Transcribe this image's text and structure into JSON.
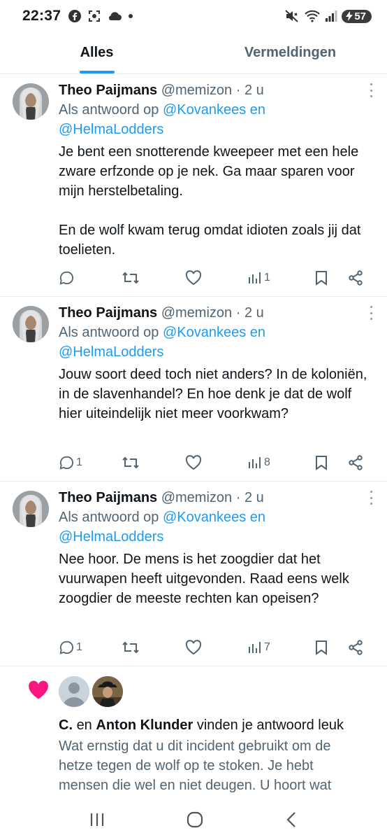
{
  "status_bar": {
    "time": "22:37",
    "battery": "57"
  },
  "tabs": [
    {
      "label": "Alles",
      "active": true
    },
    {
      "label": "Vermeldingen",
      "active": false
    }
  ],
  "tweets": [
    {
      "name": "Theo Paijmans",
      "handle": "@memizon",
      "dot": "·",
      "time": "2 u",
      "reply_prefix": "Als antwoord op",
      "reply_mention_1": "@Kovankees en",
      "reply_mention_2": "@HelmaLodders",
      "text": "Je bent een snotterende kweepeer met een hele zware erfzonde op je nek. Ga maar sparen voor mijn herstelbetaling.\n\nEn de wolf kwam terug omdat idioten zoals jij dat toelieten.",
      "replies": "",
      "views": "1"
    },
    {
      "name": "Theo Paijmans",
      "handle": "@memizon",
      "dot": "·",
      "time": "2 u",
      "reply_prefix": "Als antwoord op",
      "reply_mention_1": "@Kovankees en",
      "reply_mention_2": "@HelmaLodders",
      "text": "Jouw soort deed toch niet anders? In de koloniën, in de slavenhandel? En hoe denk je dat de wolf hier uiteindelijk niet meer voorkwam?",
      "replies": "1",
      "views": "8"
    },
    {
      "name": "Theo Paijmans",
      "handle": "@memizon",
      "dot": "·",
      "time": "2 u",
      "reply_prefix": "Als antwoord op",
      "reply_mention_1": "@Kovankees en",
      "reply_mention_2": "@HelmaLodders",
      "text": "Nee hoor. De mens is het zoogdier dat het vuurwapen heeft uitgevonden. Raad eens welk zoogdier de meeste rechten kan opeisen?",
      "replies": "1",
      "views": "7"
    }
  ],
  "like_notification": {
    "user_1": "C.",
    "connector": "en",
    "user_2": "Anton Klunder",
    "action": "vinden je antwoord leuk",
    "preview": "Wat ernstig dat u dit incident gebruikt om de hetze tegen de wolf op te stoken. Je hebt mensen die wel en niet deugen. U hoort wat"
  },
  "colors": {
    "accent": "#1d9bf0",
    "like_pink": "#f91880",
    "secondary_text": "#536471"
  }
}
